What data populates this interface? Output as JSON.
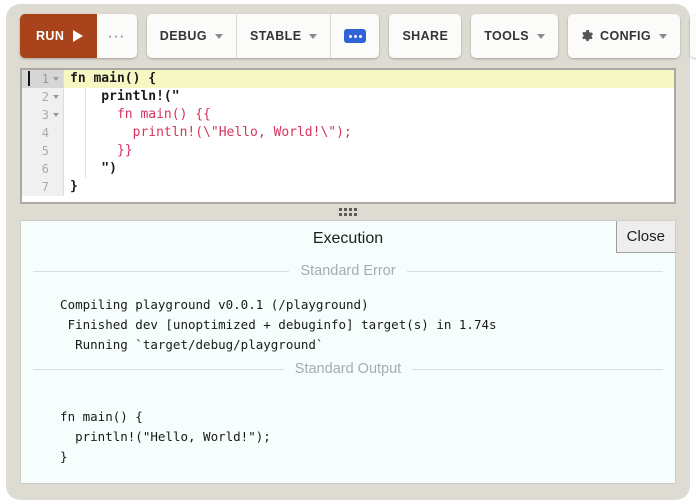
{
  "app": {
    "name": "rust-playground",
    "colors": {
      "shell_bg": "#dedcd2",
      "run_button": "#a8431c",
      "blue_accent": "#2f63d6",
      "active_line": "#f7f7c4",
      "string_literal": "#d6335c",
      "panel_bg": "#f5fdfd"
    }
  },
  "toolbar": {
    "run_label": "RUN",
    "run_overflow_label": "···",
    "debug_label": "DEBUG",
    "stable_label": "STABLE",
    "more_label": "",
    "share_label": "SHARE",
    "tools_label": "TOOLS",
    "config_label": "CONFIG",
    "help_label": "?"
  },
  "editor": {
    "lines": [
      {
        "num": "1",
        "foldable": true,
        "active": true,
        "text": "fn main() {",
        "style": "code",
        "cursor": true
      },
      {
        "num": "2",
        "foldable": true,
        "active": false,
        "text": "    println!(\"",
        "style": "code",
        "cursor": false
      },
      {
        "num": "3",
        "foldable": true,
        "active": false,
        "text": "      fn main() {{",
        "style": "str",
        "cursor": false
      },
      {
        "num": "4",
        "foldable": false,
        "active": false,
        "text": "        println!(\\\"Hello, World!\\\");",
        "style": "str",
        "cursor": false
      },
      {
        "num": "5",
        "foldable": false,
        "active": false,
        "text": "      }}",
        "style": "str",
        "cursor": false
      },
      {
        "num": "6",
        "foldable": false,
        "active": false,
        "text": "    \")",
        "style": "code",
        "cursor": false
      },
      {
        "num": "7",
        "foldable": false,
        "active": false,
        "text": "}",
        "style": "code",
        "cursor": false
      }
    ]
  },
  "execution": {
    "title": "Execution",
    "close_label": "Close",
    "stderr_label": "Standard Error",
    "stdout_label": "Standard Output",
    "stderr_text": "  Compiling playground v0.0.1 (/playground)\n   Finished dev [unoptimized + debuginfo] target(s) in 1.74s\n    Running `target/debug/playground`",
    "stdout_text": "  fn main() {\n    println!(\"Hello, World!\");\n  }"
  }
}
